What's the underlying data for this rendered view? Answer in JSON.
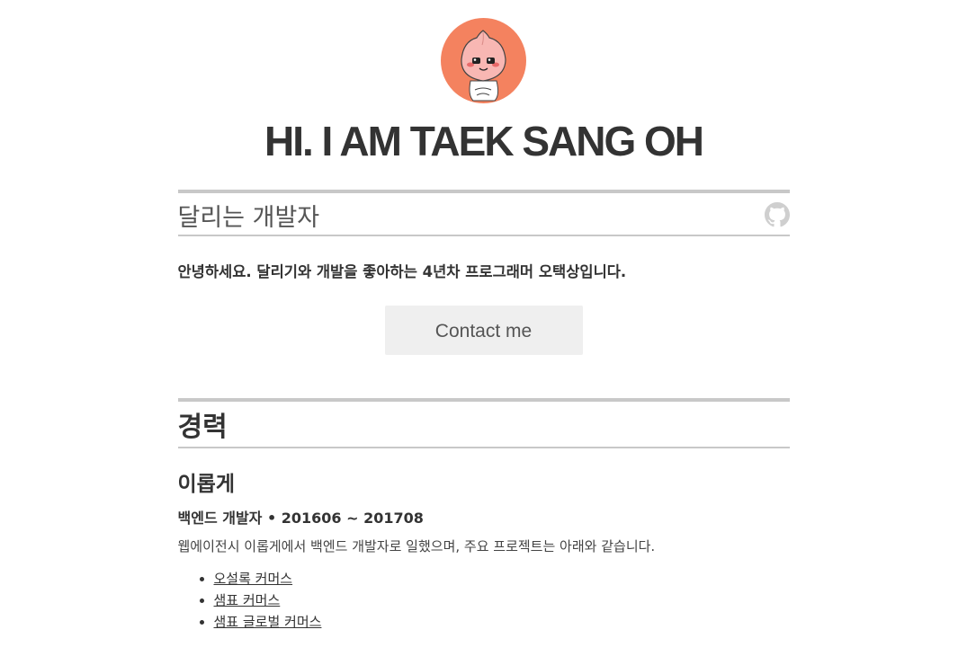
{
  "header": {
    "title": "HI. I AM TAEK SANG OH",
    "subtitle": "달리는 개발자",
    "intro": "안녕하세요. 달리기와 개발을 좋아하는 4년차 프로그래머 오택상입니다.",
    "contact_label": "Contact me",
    "avatar_icon": "peach-character-avatar",
    "github_icon": "github-icon",
    "avatar_color": "#f4825f"
  },
  "career": {
    "section_title": "경력",
    "jobs": [
      {
        "company": "이롭게",
        "role": "백엔드 개발자 • 201606 ~ 201708",
        "description": "웹에이전시 이롭게에서 백엔드 개발자로 일했으며, 주요 프로젝트는 아래와 같습니다.",
        "projects": [
          "오설록 커머스",
          "샘표 커머스",
          "샘표 글로벌 커머스"
        ]
      }
    ]
  }
}
